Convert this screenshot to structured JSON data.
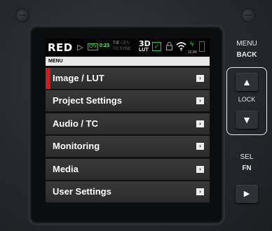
{
  "status_bar": {
    "brand": "RED",
    "brand_arrow": "▷",
    "codec_badge": "CFx",
    "timer": "0:23",
    "tc_line1": "T/E",
    "gen_line1": "GEN",
    "tc_line2": "TC",
    "sync_line2": "SYNC",
    "badge_3d": "3D",
    "badge_lut": "LUT",
    "voltage": "12.9V",
    "icons": [
      "check-icon",
      "lock-icon",
      "wifi-icon",
      "bolt-icon",
      "battery-icon"
    ]
  },
  "menu": {
    "header": "MENU",
    "items": [
      {
        "label": "Image / LUT",
        "selected": true
      },
      {
        "label": "Project Settings"
      },
      {
        "label": "Audio / TC"
      },
      {
        "label": "Monitoring"
      },
      {
        "label": "Media"
      },
      {
        "label": "User Settings"
      }
    ],
    "chevron": "›"
  },
  "side_buttons": {
    "menu_label": "MENU",
    "back_label": "BACK",
    "lock_label": "LOCK",
    "up_glyph": "▲",
    "down_glyph": "▼",
    "sel_label": "SEL",
    "fn_label": "FN",
    "play_glyph": "▶"
  },
  "colors": {
    "selected_accent": "#cc1d1d",
    "status_green": "#33cc33"
  }
}
